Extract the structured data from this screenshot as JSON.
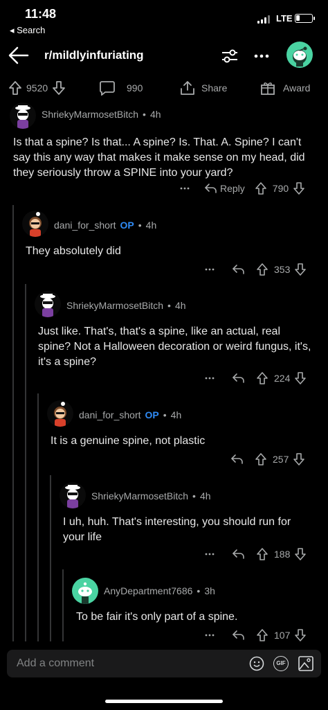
{
  "status": {
    "time": "11:48",
    "back_label": "◂ Search",
    "network": "LTE"
  },
  "header": {
    "title": "r/mildlyinfuriating"
  },
  "post_actions": {
    "upvotes": "9520",
    "comments": "990",
    "share": "Share",
    "award": "Award"
  },
  "comments": [
    {
      "user": "ShriekyMarmosetBitch",
      "op": "",
      "time": "4h",
      "body": "Is that a spine? Is that... A spine? Is. That. A. Spine? I can't say this any way that makes it make sense on my head, did they seriously throw a SPINE into your yard?",
      "reply": "Reply",
      "score": "790"
    },
    {
      "user": "dani_for_short",
      "op": "OP",
      "time": "4h",
      "body": "They absolutely did",
      "score": "353"
    },
    {
      "user": "ShriekyMarmosetBitch",
      "op": "",
      "time": "4h",
      "body": "Just like. That's, that's a spine, like an actual, real spine? Not a Halloween decoration or weird fungus, it's, it's a spine?",
      "score": "224"
    },
    {
      "user": "dani_for_short",
      "op": "OP",
      "time": "4h",
      "body": "It is a genuine spine, not plastic",
      "score": "257"
    },
    {
      "user": "ShriekyMarmosetBitch",
      "op": "",
      "time": "4h",
      "body": "I uh, huh. That's interesting, you should run for your life",
      "score": "188"
    },
    {
      "user": "AnyDepartment7686",
      "op": "",
      "time": "3h",
      "body": "To be fair it's only part of a spine.",
      "score": "107"
    }
  ],
  "comment_bar": {
    "placeholder": "Add a comment",
    "gif_label": "GIF"
  },
  "colors": {
    "background": "#000000",
    "op_blue": "#2f8bf5",
    "avatar_mint": "#4ad3a2"
  }
}
